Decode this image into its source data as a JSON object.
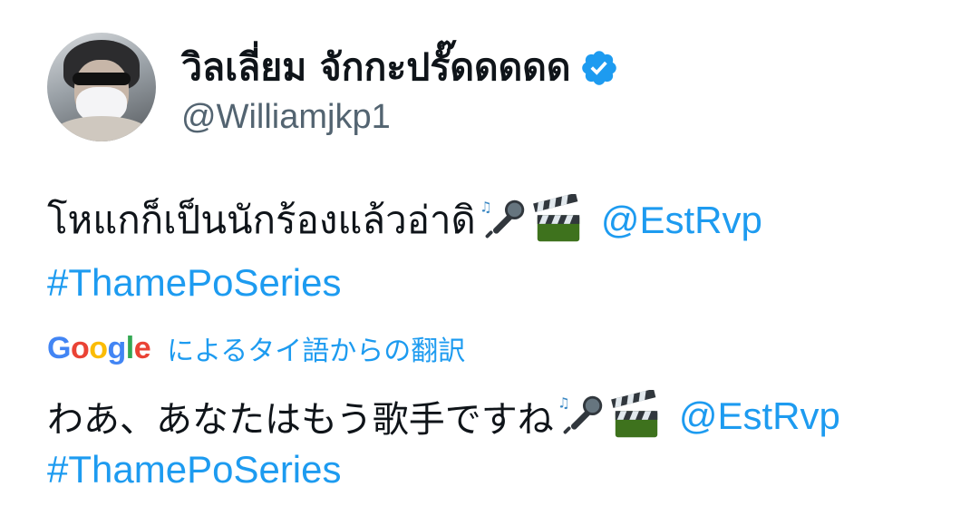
{
  "profile": {
    "display_name": "วิลเลี่ยม จักกะปรั๊ดดดดด",
    "handle": "@Williamjkp1",
    "verified_color": "#1d9bf0"
  },
  "tweet": {
    "text": "โหแกก็เป็นนักร้องแล้วอ่าดิ",
    "emojis": [
      "microphone-emoji",
      "clapper-board-emoji"
    ],
    "mention": "@EstRvp",
    "hashtag": "#ThamePoSeries"
  },
  "translation": {
    "provider": {
      "letters": [
        "G",
        "o",
        "o",
        "g",
        "l",
        "e"
      ]
    },
    "label": "によるタイ語からの翻訳",
    "text": "わあ、あなたはもう歌手ですね",
    "mention": "@EstRvp",
    "hashtag": "#ThamePoSeries"
  },
  "colors": {
    "link": "#1d9bf0",
    "text": "#0f1419",
    "secondary": "#536471",
    "google_blue": "#4285f4",
    "google_red": "#ea4335",
    "google_yellow": "#fbbc05",
    "google_green": "#34a853"
  }
}
